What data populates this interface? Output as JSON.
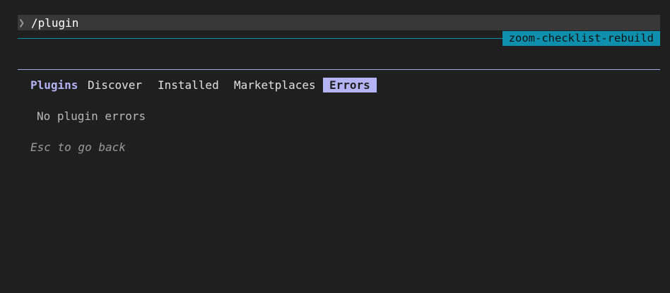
{
  "command": {
    "prompt_icon": "chevron-right-icon",
    "text": "/plugin"
  },
  "branch_badge": "zoom-checklist-rebuild",
  "tabs": {
    "title": "Plugins",
    "items": [
      {
        "label": "Discover",
        "selected": false
      },
      {
        "label": "Installed",
        "selected": false
      },
      {
        "label": "Marketplaces",
        "selected": false
      },
      {
        "label": "Errors",
        "selected": true
      }
    ]
  },
  "content": {
    "empty_message": "No plugin errors"
  },
  "footer_hint": "Esc to go back",
  "colors": {
    "background": "#1f1f1f",
    "accent_cyan": "#0e8fae",
    "accent_lavender": "#b4b4f4",
    "command_bar": "#383838"
  }
}
